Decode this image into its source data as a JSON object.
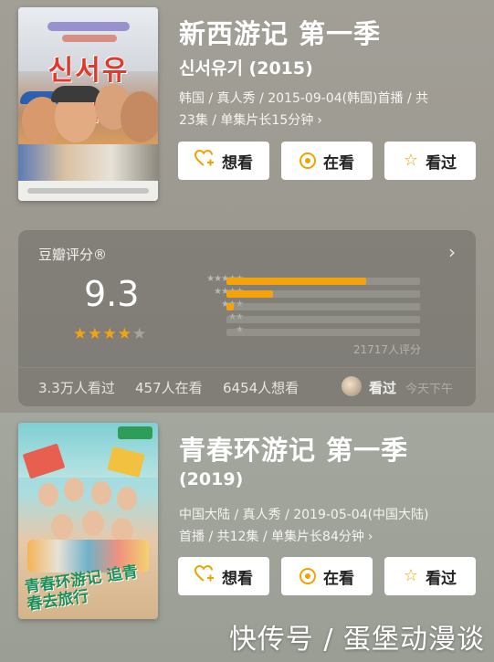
{
  "show1": {
    "title": "新西游记 第一季",
    "subtitle": "신서유기 (2015)",
    "meta_line1": "韩国 / 真人秀 / 2015-09-04(韩国)首播 / 共",
    "meta_line2": "23集 / 单集片长15分钟",
    "poster_logo": "신서유기",
    "buttons": {
      "want": "想看",
      "watching": "在看",
      "watched": "看过"
    }
  },
  "rating": {
    "label": "豆瓣评分®",
    "score": "9.3",
    "stars_text": "★★★★",
    "stars_half": "★",
    "distribution": [
      {
        "stars": "★★★★★",
        "fraction": 0.72
      },
      {
        "stars": "★★★★",
        "fraction": 0.24
      },
      {
        "stars": "★★★",
        "fraction": 0.04
      },
      {
        "stars": "★★",
        "fraction": 0.0
      },
      {
        "stars": "★",
        "fraction": 0.0
      }
    ],
    "count": "21717人评分",
    "watched_count": "3.3万人看过",
    "watching_count": "457人在看",
    "want_count": "6454人想看",
    "my_status": "看过",
    "my_time": "今天下午"
  },
  "show2": {
    "title": "青春环游记 第一季",
    "subtitle": "(2019)",
    "meta_line1": "中国大陆 / 真人秀 / 2019-05-04(中国大陆)",
    "meta_line2": "首播 / 共12集 / 单集片长84分钟",
    "poster_title": "青春环游记 追青春去旅行",
    "buttons": {
      "want": "想看",
      "watching": "在看",
      "watched": "看过"
    }
  },
  "watermark": "快传号 / 蛋堡动漫谈",
  "colors": {
    "accent": "#f5a30c",
    "icon": "#f0a300"
  },
  "icons": {
    "want": "heart-plus-icon",
    "watching": "target-circle-icon",
    "watched": "star-outline-icon",
    "more": "chevron-right-icon"
  }
}
